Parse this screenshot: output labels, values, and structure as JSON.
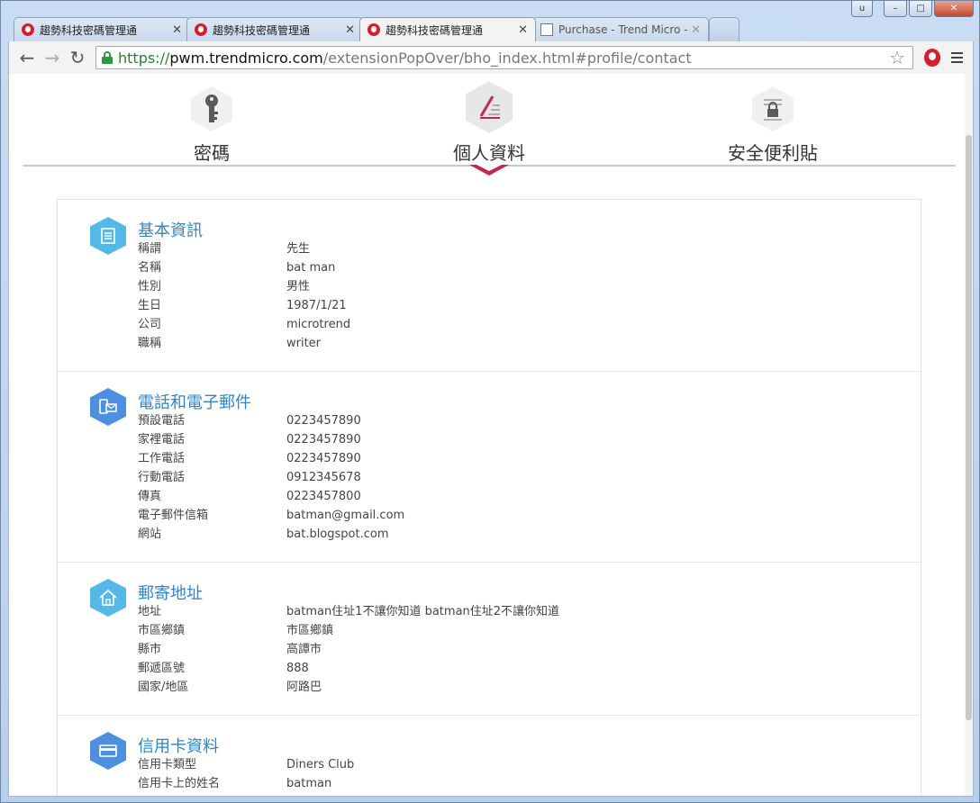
{
  "window": {
    "user_button": "u",
    "minimize": "–",
    "maximize": "□",
    "close": "✕"
  },
  "tabs": [
    {
      "title": "趨勢科技密碼管理通",
      "icon": "trendmicro-icon",
      "active": false
    },
    {
      "title": "趨勢科技密碼管理通",
      "icon": "trendmicro-icon",
      "active": false
    },
    {
      "title": "趨勢科技密碼管理通",
      "icon": "trendmicro-icon",
      "active": true
    },
    {
      "title": "Purchase - Trend Micro -",
      "icon": "document-icon",
      "active": false
    }
  ],
  "toolbar": {
    "back": "←",
    "forward": "→",
    "reload": "↻",
    "url_scheme": "https://",
    "url_host": "pwm.trendmicro.com",
    "url_path": "/extensionPopOver/bho_index.html#profile/contact",
    "star": "☆"
  },
  "profile_nav": {
    "items": [
      {
        "label": "密碼",
        "icon": "key-icon"
      },
      {
        "label": "個人資料",
        "icon": "pen-icon",
        "active": true
      },
      {
        "label": "安全便利貼",
        "icon": "secure-note-icon"
      }
    ]
  },
  "sections": {
    "basic": {
      "title": "基本資訊",
      "rows": [
        {
          "k": "稱謂",
          "v": "先生"
        },
        {
          "k": "名稱",
          "v": "bat man"
        },
        {
          "k": "性別",
          "v": "男性"
        },
        {
          "k": "生日",
          "v": "1987/1/21"
        },
        {
          "k": "公司",
          "v": "microtrend"
        },
        {
          "k": "職稱",
          "v": "writer"
        }
      ]
    },
    "contact": {
      "title": "電話和電子郵件",
      "rows": [
        {
          "k": "預設電話",
          "v": "0223457890"
        },
        {
          "k": "家裡電話",
          "v": "0223457890"
        },
        {
          "k": "工作電話",
          "v": "0223457890"
        },
        {
          "k": "行動電話",
          "v": "0912345678"
        },
        {
          "k": "傳真",
          "v": "0223457800"
        },
        {
          "k": "電子郵件信箱",
          "v": "batman@gmail.com"
        },
        {
          "k": "網站",
          "v": "bat.blogspot.com"
        }
      ]
    },
    "address": {
      "title": "郵寄地址",
      "rows": [
        {
          "k": "地址",
          "v": "batman住址1不讓你知道 batman住址2不讓你知道"
        },
        {
          "k": "市區鄉鎮",
          "v": "市區鄉鎮"
        },
        {
          "k": "縣市",
          "v": "高譚市"
        },
        {
          "k": "郵遞區號",
          "v": "888"
        },
        {
          "k": "國家/地區",
          "v": "阿路巴"
        }
      ]
    },
    "card": {
      "title": "信用卡資料",
      "rows": [
        {
          "k": "信用卡類型",
          "v": "Diners Club"
        },
        {
          "k": "信用卡上的姓名",
          "v": "batman"
        }
      ]
    }
  },
  "colors": {
    "accent_red": "#c3284a",
    "section_title": "#2e86c9",
    "url_green": "#1a8a2a"
  }
}
